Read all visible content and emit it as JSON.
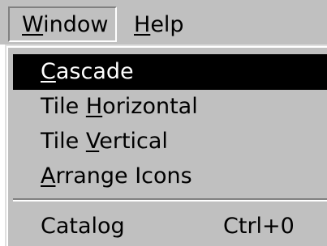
{
  "menubar": {
    "items": [
      {
        "label": "Window",
        "mnemonic": "W",
        "rest": "indow",
        "active": true
      },
      {
        "label": "Help",
        "mnemonic": "H",
        "rest": "elp",
        "active": false
      }
    ]
  },
  "window_menu": {
    "items": [
      {
        "label": "Cascade",
        "mnemonic": "C",
        "pre": "",
        "rest": "ascade",
        "selected": true
      },
      {
        "label": "Tile Horizontal",
        "pre": "Tile ",
        "mnemonic": "H",
        "rest": "orizontal",
        "selected": false
      },
      {
        "label": "Tile Vertical",
        "pre": "Tile ",
        "mnemonic": "V",
        "rest": "ertical",
        "selected": false
      },
      {
        "label": "Arrange Icons",
        "pre": "",
        "mnemonic": "A",
        "rest": "rrange Icons",
        "selected": false
      },
      {
        "label": "Catalog",
        "shortcut": "Ctrl+0",
        "selected": false
      }
    ]
  },
  "colors": {
    "menu_background": "#c0c0c0",
    "selection_background": "#000000",
    "selection_text": "#ffffff",
    "text": "#000000"
  }
}
